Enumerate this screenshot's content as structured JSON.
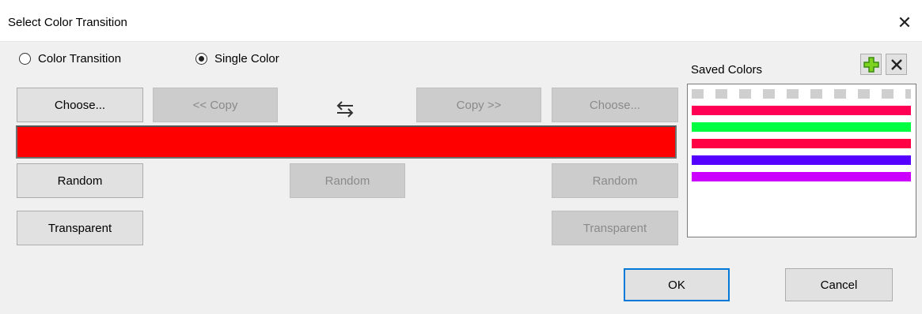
{
  "window": {
    "title": "Select Color Transition",
    "close_icon": "close-icon"
  },
  "mode": {
    "options": [
      "Color Transition",
      "Single Color"
    ],
    "selected": "Single Color"
  },
  "left": {
    "choose": "Choose...",
    "random": "Random",
    "transparent": "Transparent"
  },
  "middle": {
    "copy_left": "<< Copy",
    "copy_right": "Copy >>",
    "random": "Random",
    "swap_icon": "swap-arrows-icon"
  },
  "right": {
    "choose": "Choose...",
    "random": "Random",
    "transparent": "Transparent"
  },
  "current_color": "#ff0000",
  "saved": {
    "label": "Saved Colors",
    "add_icon": "plus-icon",
    "delete_icon": "x-icon",
    "swatches": [
      "transparent",
      "#ff0055",
      "#00ff40",
      "#ff0044",
      "#5500ff",
      "#cc00ff"
    ]
  },
  "footer": {
    "ok": "OK",
    "cancel": "Cancel"
  }
}
